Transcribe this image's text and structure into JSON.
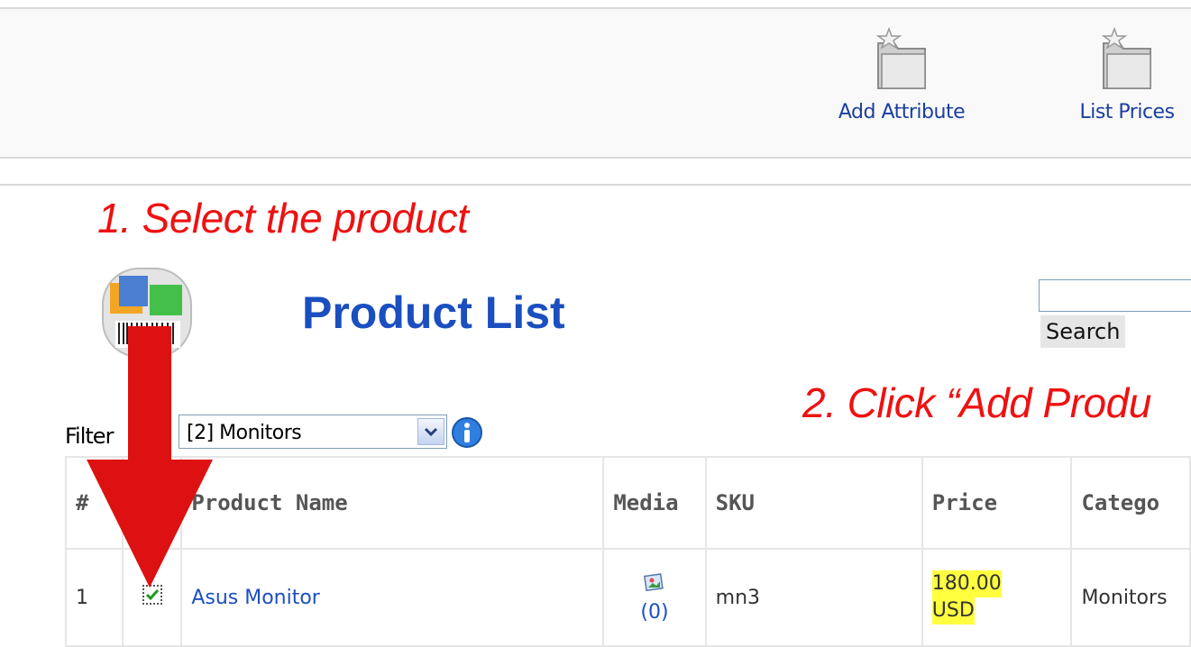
{
  "toolbar": {
    "add_attribute": "Add Attribute",
    "list_prices": "List Prices"
  },
  "annotations": {
    "step1": "1. Select the product",
    "step2": "2. Click “Add Produ"
  },
  "page": {
    "title": "Product List"
  },
  "search": {
    "value": "",
    "button_label": "Search"
  },
  "filter": {
    "label": "Filter",
    "selected": "[2] Monitors"
  },
  "table": {
    "headers": {
      "num": "#",
      "name": "Product Name",
      "media": "Media",
      "sku": "SKU",
      "price": "Price",
      "category": "Catego"
    },
    "rows": [
      {
        "num": "1",
        "checked": true,
        "name": "Asus Monitor",
        "media_count": "(0)",
        "sku": "mn3",
        "price_line1": "180.00",
        "price_line2": "USD",
        "category": "Monitors"
      }
    ]
  },
  "colors": {
    "annotation": "#ee1111",
    "link": "#1b4fbf",
    "arrow": "#dd1111",
    "price_highlight": "#ffff40"
  },
  "icons": {
    "toolbar": "star-folder-icon",
    "logo": "product-boxes-barcode-icon",
    "info": "info-icon",
    "media": "image-icon",
    "arrow": "down-arrow-icon"
  }
}
